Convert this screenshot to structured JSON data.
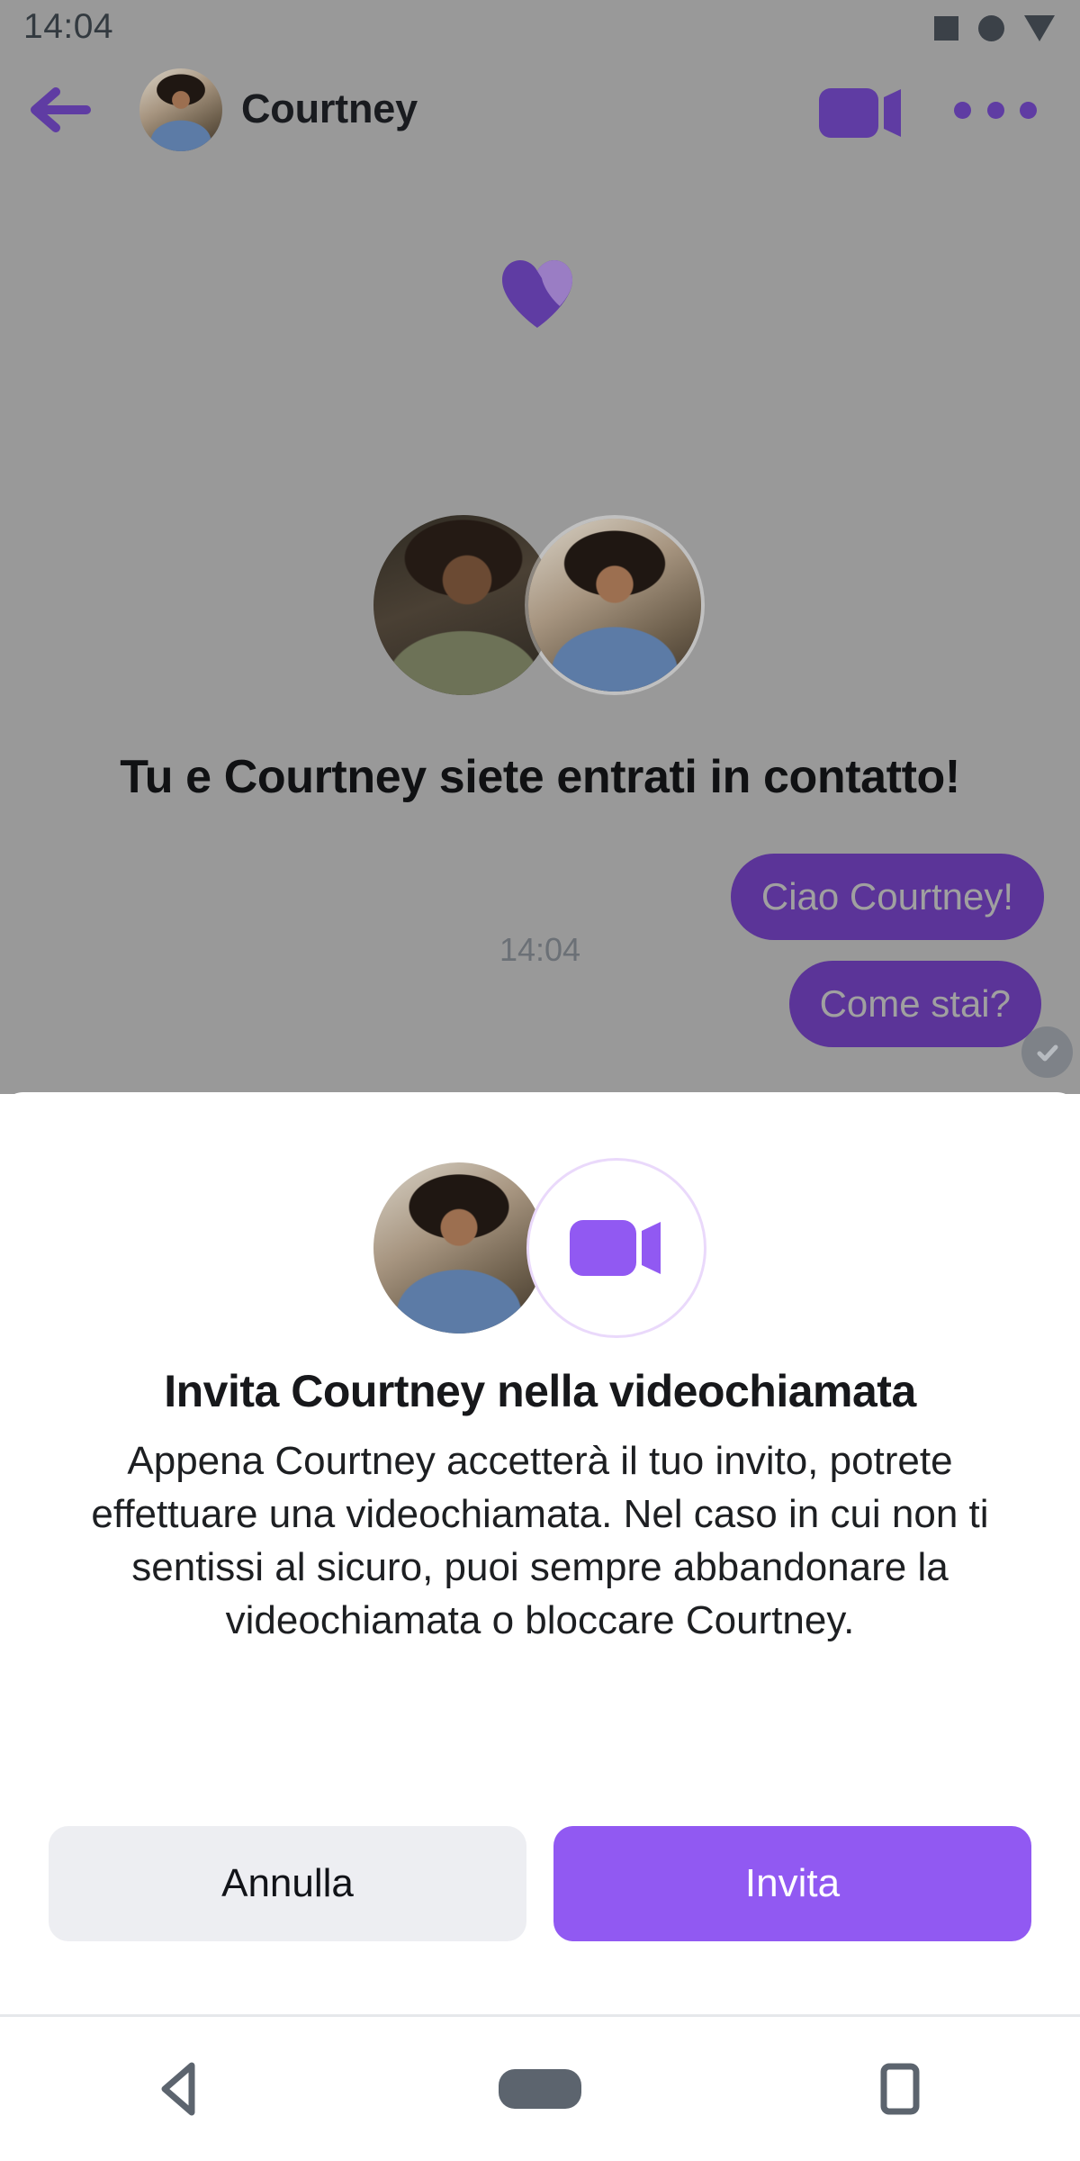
{
  "status_bar": {
    "time": "14:04",
    "icons": [
      "square-icon",
      "circle-icon",
      "triangle-down-icon"
    ]
  },
  "chat_header": {
    "back_icon": "back-arrow-icon",
    "avatar": "contact-avatar",
    "contact_name": "Courtney",
    "video_call_icon": "video-camera-icon",
    "more_icon": "more-options-icon"
  },
  "connection_card": {
    "heart_icon": "two-tone-heart-icon",
    "avatar_left": "user-avatar",
    "avatar_right": "contact-avatar",
    "title": "Tu e Courtney siete entrati in contatto!",
    "timestamp": "14:04"
  },
  "messages": [
    {
      "text": "Ciao Courtney!",
      "side": "outgoing"
    },
    {
      "text": "Come stai?",
      "side": "outgoing"
    }
  ],
  "read_receipt": {
    "icon": "check-circle-icon"
  },
  "modal": {
    "avatar": "contact-avatar",
    "video_icon": "video-camera-icon",
    "title": "Invita Courtney nella videochiamata",
    "body": "Appena Courtney accetterà il tuo invito, potrete effettuare una videochiamata. Nel caso in cui non ti sentissi al sicuro, puoi sempre abbandonare la videochiamata o bloccare Courtney.",
    "cancel_label": "Annulla",
    "invite_label": "Invita"
  },
  "system_nav": {
    "back_icon": "nav-back-triangle-icon",
    "home_icon": "nav-home-pill-icon",
    "recents_icon": "nav-recents-square-icon"
  },
  "colors": {
    "brand_purple": "#5f3ca3",
    "bubble_purple": "#5b3498",
    "invite_purple": "#9159f2",
    "cancel_grey": "#edeef2",
    "scrim_grey": "#999999",
    "status_icon": "#3b4148",
    "nav_icon": "#5c646e"
  }
}
